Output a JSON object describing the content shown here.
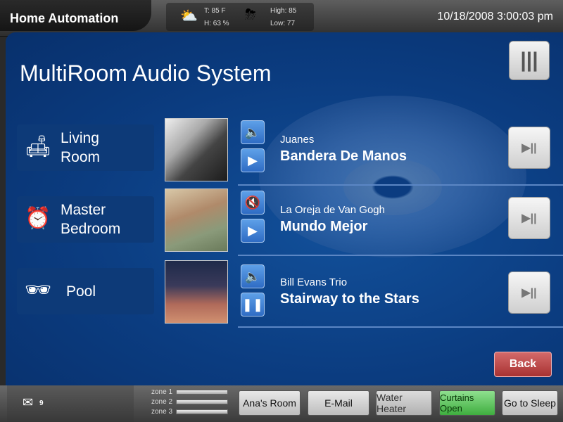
{
  "header": {
    "app_title": "Home Automation",
    "temp": "T:  85 F",
    "humidity": "H: 63 %",
    "high": "High: 85",
    "low": "Low: 77",
    "datetime": "10/18/2008 3:00:03 pm",
    "weather_icon_current": "partly-cloudy-icon",
    "weather_icon_forecast": "thunderstorm-icon"
  },
  "main": {
    "title": "MultiRoom Audio System",
    "rooms": [
      {
        "label": "Living\nRoom",
        "icon": "armchair-icon",
        "artist": "Juanes",
        "song": "Bandera De Manos",
        "mute_icon": "speaker-icon",
        "play_state": "play"
      },
      {
        "label": "Master\nBedroom",
        "icon": "alarm-clock-icon",
        "artist": "La Oreja de Van Gogh",
        "song": "Mundo Mejor",
        "mute_icon": "speaker-muted-icon",
        "play_state": "play"
      },
      {
        "label": "Pool",
        "icon": "sunglasses-icon",
        "artist": "Bill Evans Trio",
        "song": "Stairway to the Stars",
        "mute_icon": "speaker-icon",
        "play_state": "pause"
      }
    ],
    "back_label": "Back"
  },
  "footer": {
    "mail_count": "9",
    "zones": [
      "zone 1",
      "zone 2",
      "zone 3"
    ],
    "buttons": {
      "anas_room": "Ana's Room",
      "email": "E-Mail",
      "water_heater": "Water Heater",
      "curtains_open": "Curtains Open",
      "go_to_sleep": "Go to Sleep"
    }
  },
  "colors": {
    "panel_blue": "#0b3c80",
    "button_blue": "#2f6cc4",
    "back_red": "#a83232",
    "active_green": "#3fae3f"
  }
}
